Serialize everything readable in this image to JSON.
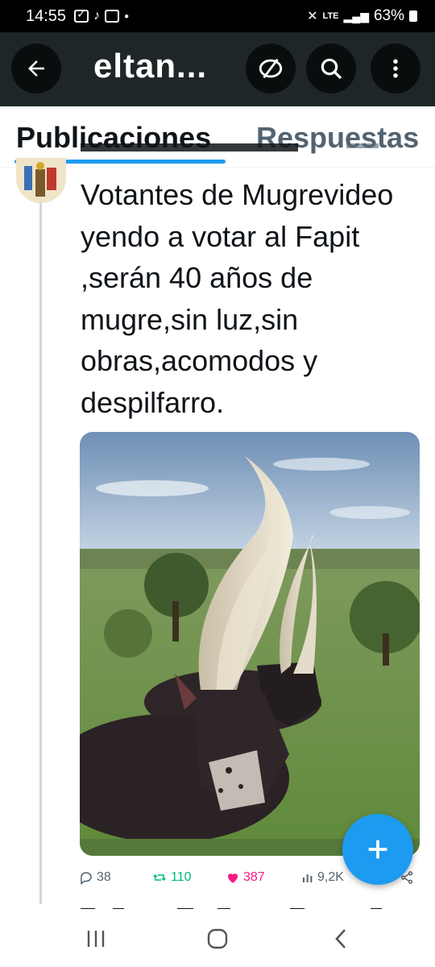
{
  "status_bar": {
    "time": "14:55",
    "network": "LTE",
    "battery": "63%"
  },
  "header": {
    "title": "eltan...",
    "back_icon": "arrow-left-icon",
    "hide_icon": "eye-slash-icon",
    "search_icon": "search-icon",
    "more_icon": "more-vertical-icon"
  },
  "tabs": [
    {
      "label": "Publicaciones",
      "active": true
    },
    {
      "label": "Respuestas",
      "active": false
    }
  ],
  "post": {
    "text": "Votantes de Mugrevideo yendo a votar al Fapit ,serán 40 años de mugre,sin luz,sin obras,acomodos y despilfarro.",
    "image_alt": "Two Ankole cattle with very long curved horns resting on grass",
    "stats": {
      "replies": "38",
      "retweets": "110",
      "likes": "387",
      "views": "9,2K"
    }
  },
  "colors": {
    "accent": "#1d9bf0",
    "retweet": "#00ba7c",
    "like": "#f91880",
    "muted": "#536471",
    "header_bg": "#1f2628"
  },
  "nav": {
    "recent_icon": "recent-apps-icon",
    "home_icon": "home-icon",
    "back_icon": "back-chevron-icon"
  }
}
